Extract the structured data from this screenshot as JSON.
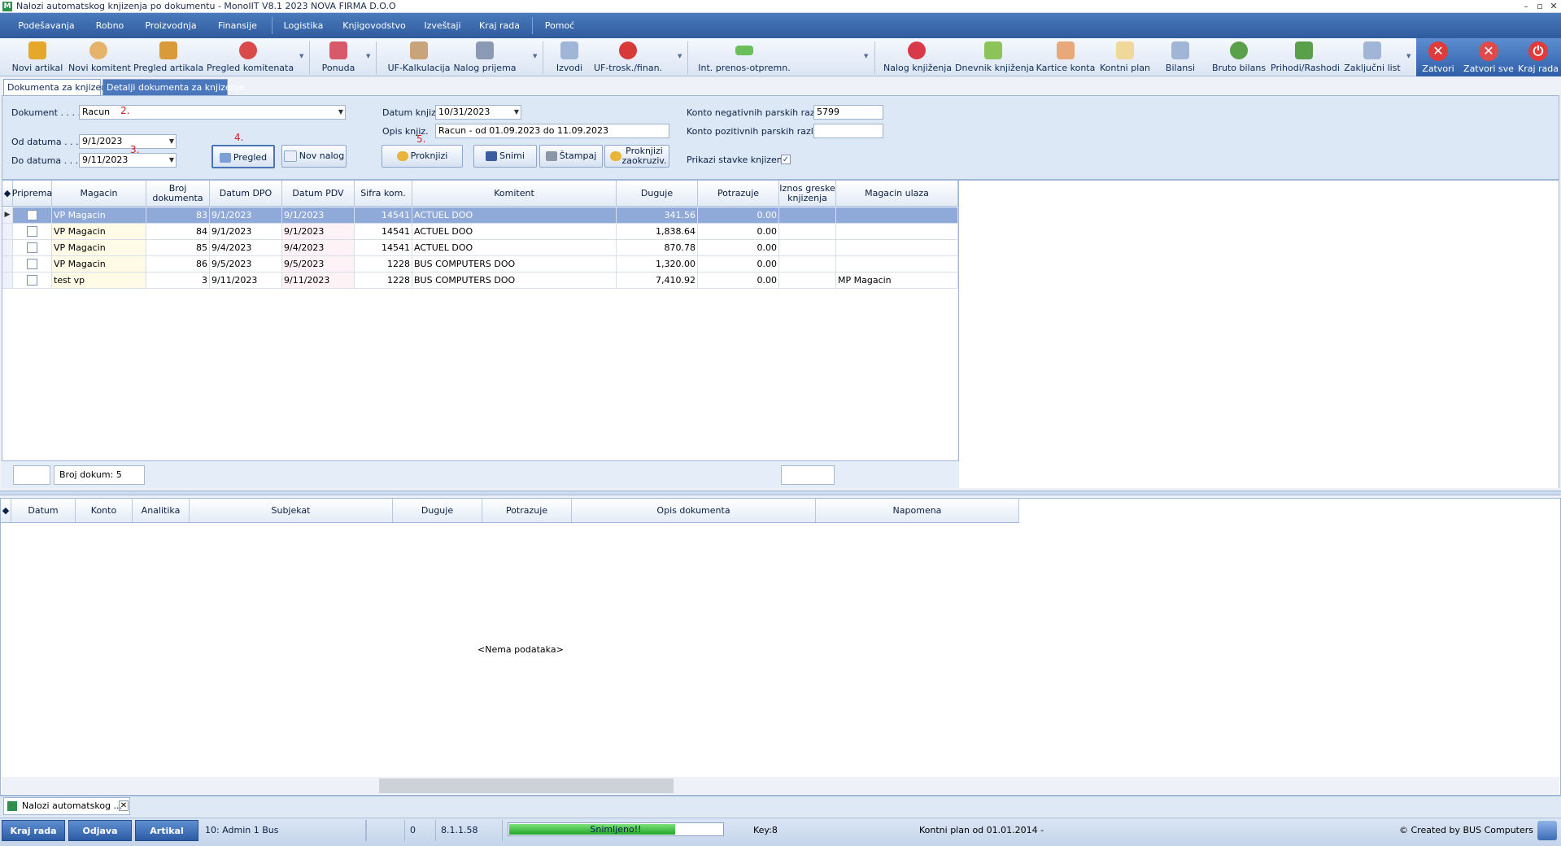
{
  "window": {
    "title": "Nalozi automatskog knjizenja po dokumentu - MonoIIT V8.1 2023 NOVA FIRMA D.O.O",
    "controls": [
      "–",
      "▫",
      "✕"
    ]
  },
  "menu": [
    "Podešavanja",
    "Robno",
    "Proizvodnja",
    "Finansije",
    "Logistika",
    "Knjigovodstvo",
    "Izveštaji",
    "Kraj rada",
    "Pomoć"
  ],
  "toolbar": {
    "items": [
      {
        "label": "Novi artikal",
        "icon": "box-icon",
        "color": "#e6a82a"
      },
      {
        "label": "Novi komitent",
        "icon": "user-add-icon",
        "color": "#e6b36a"
      },
      {
        "label": "Pregled artikala",
        "icon": "boxes-icon",
        "color": "#d99a3a"
      },
      {
        "label": "Pregled komitenata",
        "icon": "users-icon",
        "color": "#d94a4a"
      },
      {
        "label": "Ponuda",
        "icon": "offer-icon",
        "color": "#d85a6a"
      },
      {
        "label": "UF-Kalkulacija",
        "icon": "calc-icon",
        "color": "#c9a47a"
      },
      {
        "label": "Nalog prijema",
        "icon": "receipt-icon",
        "color": "#8a9ab5"
      },
      {
        "label": "Izvodi",
        "icon": "statement-icon",
        "color": "#9fb6d6"
      },
      {
        "label": "UF-trosk./finan.",
        "icon": "cost-icon",
        "color": "#d83a3a"
      },
      {
        "label": "Int. prenos-otpremn.",
        "icon": "transfer-icon",
        "color": "#6abf5a"
      },
      {
        "label": "Nalog knjiženja",
        "icon": "ledger-order-icon",
        "color": "#d83a4a"
      },
      {
        "label": "Dnevnik knjiženja",
        "icon": "journal-icon",
        "color": "#8cc45a"
      },
      {
        "label": "Kartice konta",
        "icon": "cards-icon",
        "color": "#e8a87a"
      },
      {
        "label": "Kontni plan",
        "icon": "chart-of-accounts-icon",
        "color": "#f0d89a"
      },
      {
        "label": "Bilansi",
        "icon": "balance-icon",
        "color": "#9fb6d6"
      },
      {
        "label": "Bruto bilans",
        "icon": "pie-icon",
        "color": "#5aa04a"
      },
      {
        "label": "Prihodi/Rashodi",
        "icon": "income-icon",
        "color": "#5aa04a"
      },
      {
        "label": "Zaključni list",
        "icon": "closing-icon",
        "color": "#9fb6d6"
      }
    ],
    "right": [
      {
        "label": "Zatvori",
        "icon": "close-icon",
        "glyph": "✕",
        "color": "#e03a3a"
      },
      {
        "label": "Zatvori sve",
        "icon": "close-all-icon",
        "glyph": "✕",
        "color": "#e04a4a"
      },
      {
        "label": "Kraj rada",
        "icon": "power-icon",
        "glyph": "⏻",
        "color": "#e03a3a"
      }
    ]
  },
  "tabs": [
    "Dokumenta za knjizenje",
    "Detalji dokumenta za knjizenje"
  ],
  "form": {
    "dokument_label": "Dokument . . . .",
    "dokument_value": "Racun",
    "od_label": "Od datuma . . . .",
    "od_value": "9/1/2023",
    "do_label": "Do datuma . . . .",
    "do_value": "9/11/2023",
    "datum_knjiz_label": "Datum knjiz.",
    "datum_knjiz_value": "10/31/2023",
    "opis_label": "Opis knjiz.",
    "opis_value": "Racun - od 01.09.2023 do 11.09.2023",
    "konto_neg_label": "Konto negativnih parskih razlika",
    "konto_neg_value": "5799",
    "konto_poz_label": "Konto pozitivnih parskih razlika",
    "konto_poz_value": "",
    "prikazi_label": "Prikazi stavke knjizenja",
    "prikazi_checked": "✓",
    "btn_pregled": "Pregled",
    "btn_nov_nalog": "Nov nalog",
    "btn_proknjizi": "Proknjizi",
    "btn_snimi": "Snimi",
    "btn_stampaj": "Štampaj",
    "btn_proknjizi_zaokr_1": "Proknjizi",
    "btn_proknjizi_zaokr_2": "zaokruziv.",
    "steps": [
      "2.",
      "3.",
      "4.",
      "5."
    ]
  },
  "grid1": {
    "columns": [
      "Priprema",
      "Magacin",
      "Broj dokumenta",
      "Datum DPO",
      "Datum PDV",
      "Sifra kom.",
      "Komitent",
      "Duguje",
      "Potrazuje",
      "Iznos greske knjizenja",
      "Magacin ulaza"
    ],
    "rows": [
      {
        "magacin": "VP Magacin",
        "broj": "83",
        "dpo": "9/1/2023",
        "pdv": "9/1/2023",
        "sifra": "14541",
        "komitent": "ACTUEL DOO",
        "duguje": "341.56",
        "potrazuje": "0.00",
        "greska": "",
        "ulaz": ""
      },
      {
        "magacin": "VP Magacin",
        "broj": "84",
        "dpo": "9/1/2023",
        "pdv": "9/1/2023",
        "sifra": "14541",
        "komitent": "ACTUEL DOO",
        "duguje": "1,838.64",
        "potrazuje": "0.00",
        "greska": "",
        "ulaz": ""
      },
      {
        "magacin": "VP Magacin",
        "broj": "85",
        "dpo": "9/4/2023",
        "pdv": "9/4/2023",
        "sifra": "14541",
        "komitent": "ACTUEL DOO",
        "duguje": "870.78",
        "potrazuje": "0.00",
        "greska": "",
        "ulaz": ""
      },
      {
        "magacin": "VP Magacin",
        "broj": "86",
        "dpo": "9/5/2023",
        "pdv": "9/5/2023",
        "sifra": "1228",
        "komitent": "BUS COMPUTERS DOO",
        "duguje": "1,320.00",
        "potrazuje": "0.00",
        "greska": "",
        "ulaz": ""
      },
      {
        "magacin": "test vp",
        "broj": "3",
        "dpo": "9/11/2023",
        "pdv": "9/11/2023",
        "sifra": "1228",
        "komitent": "BUS COMPUTERS DOO",
        "duguje": "7,410.92",
        "potrazuje": "0.00",
        "greska": "",
        "ulaz": "MP Magacin"
      }
    ],
    "footer_count": "Broj dokum: 5"
  },
  "grid2": {
    "columns": [
      "Datum",
      "Konto",
      "Analitika",
      "Subjekat",
      "Duguje",
      "Potrazuje",
      "Opis dokumenta",
      "Napomena"
    ],
    "empty_text": "<Nema podataka>"
  },
  "mdi_tab": "Nalozi automatskog ...",
  "statusbar": {
    "btn_kraj": "Kraj rada",
    "btn_odjava": "Odjava",
    "btn_artikal": "Artikal",
    "user": "10: Admin 1 Bus",
    "zero": "0",
    "version": "8.1.1.58",
    "progress_text": "Snimljeno!!",
    "progress_fraction": 1.0,
    "key": "Key:8",
    "kontni_plan": "Kontni plan od 01.01.2014 -",
    "credits": "© Created by BUS Computers"
  }
}
